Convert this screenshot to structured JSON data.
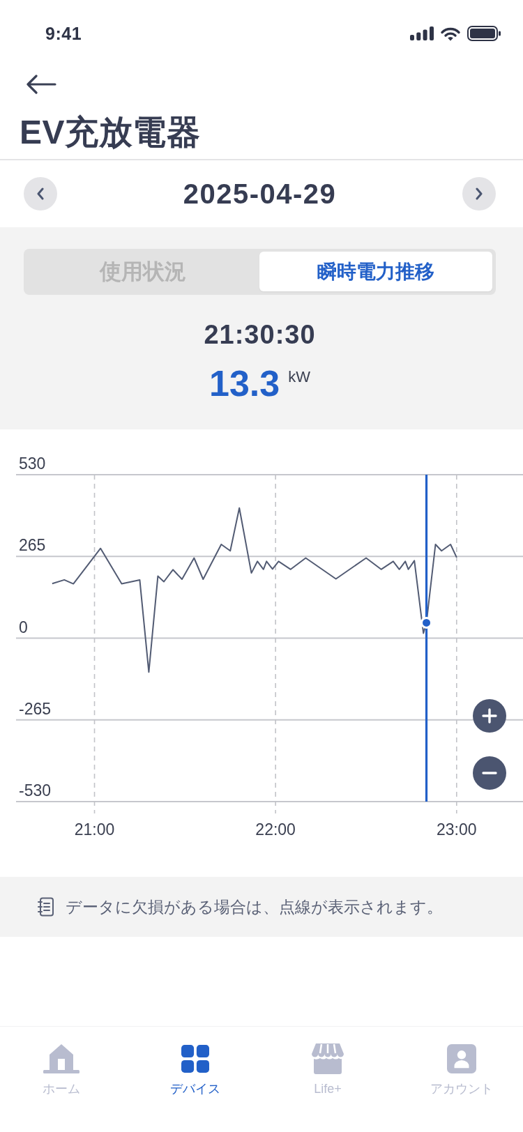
{
  "status_bar": {
    "time": "9:41"
  },
  "header": {
    "title": "EV充放電器"
  },
  "date_nav": {
    "date": "2025-04-29"
  },
  "tabs": [
    {
      "label": "使用状況",
      "selected": false
    },
    {
      "label": "瞬時電力推移",
      "selected": true
    }
  ],
  "reading": {
    "time": "21:30:30",
    "value": "13.3",
    "unit": "kW"
  },
  "chart": {
    "chart_data": {
      "type": "line",
      "x": [
        1246,
        1250,
        1253,
        1262,
        1269,
        1275,
        1278,
        1281,
        1283,
        1286,
        1289,
        1293,
        1296,
        1302,
        1305,
        1308,
        1312,
        1314,
        1316,
        1317,
        1319,
        1321,
        1325,
        1330,
        1340,
        1350,
        1355,
        1359,
        1361,
        1363,
        1364,
        1366,
        1369,
        1370,
        1373,
        1375,
        1378,
        1380
      ],
      "values": [
        177,
        189,
        176,
        291,
        176,
        189,
        -110,
        201,
        183,
        222,
        191,
        260,
        191,
        304,
        283,
        422,
        211,
        249,
        223,
        249,
        224,
        249,
        223,
        260,
        192,
        260,
        223,
        249,
        223,
        249,
        223,
        251,
        16,
        50,
        304,
        283,
        304,
        262
      ],
      "xlim": [
        1234,
        1402
      ],
      "ylim": [
        -530,
        530
      ],
      "xticks": [
        {
          "value": 1260,
          "label": "21:00"
        },
        {
          "value": 1320,
          "label": "22:00"
        },
        {
          "value": 1380,
          "label": "23:00"
        }
      ],
      "yticks": [
        530,
        265,
        0,
        -265,
        -530
      ],
      "grid": true,
      "ref_lines": [
        {
          "axis": "x",
          "value": 1370,
          "color": "#2260c8"
        }
      ]
    }
  },
  "note": {
    "text": "データに欠損がある場合は、点線が表示されます。"
  },
  "bottom_nav": {
    "items": [
      {
        "kind": "home",
        "label": "ホーム",
        "selected": false
      },
      {
        "kind": "devices",
        "label": "デバイス",
        "selected": true
      },
      {
        "kind": "store",
        "label": "Life+",
        "selected": false
      },
      {
        "kind": "account",
        "label": "アカウント",
        "selected": false
      }
    ]
  }
}
